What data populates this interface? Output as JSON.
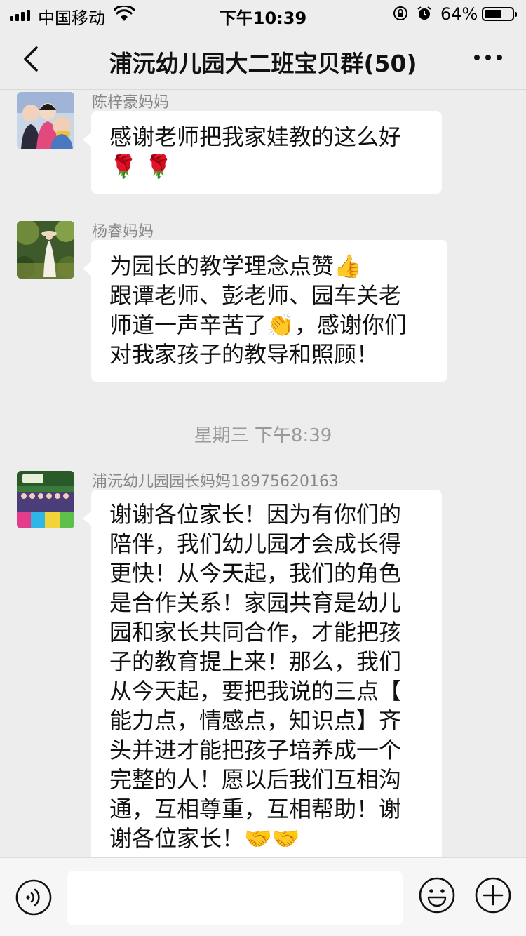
{
  "status_bar": {
    "carrier": "中国移动",
    "time": "下午10:39",
    "battery_percent": "64%",
    "battery_level": 0.64,
    "icons": [
      "signal-icon",
      "wifi-icon",
      "orientation-lock-icon",
      "alarm-icon",
      "battery-icon"
    ]
  },
  "nav": {
    "title": "浦沅幼儿园大二班宝贝群(50)",
    "back_icon": "chevron-left-icon",
    "more_icon": "more-dots-icon"
  },
  "messages": [
    {
      "sender": "陈梓豪妈妈",
      "lines": [
        "感谢老师把我家娃教的这么好",
        "🌹 🌹"
      ],
      "avatar": "family-photo-avatar"
    },
    {
      "sender": "杨睿妈妈",
      "lines": [
        "为园长的教学理念点赞👍",
        "跟谭老师、彭老师、园车关老",
        "师道一声辛苦了👏，感谢你们",
        "对我家孩子的教导和照顾！"
      ],
      "avatar": "garden-lady-avatar"
    },
    {
      "sender": "浦沅幼儿园园长妈妈18975620163",
      "lines": [
        "谢谢各位家长！因为有你们的",
        "陪伴，我们幼儿园才会成长得",
        "更快！从今天起，我们的角色",
        "是合作关系！家园共育是幼儿",
        "园和家长共同合作，才能把孩",
        "子的教育提上来！那么，我们",
        "从今天起，要把我说的三点【",
        "能力点，情感点，知识点】齐",
        "头并进才能把孩子培养成一个",
        "完整的人！愿以后我们互相沟",
        "通，互相尊重，互相帮助！谢",
        "谢各位家长！🤝🤝"
      ],
      "avatar": "kindergarten-group-avatar"
    }
  ],
  "timestamp": "星期三 下午8:39",
  "input_bar": {
    "voice_icon": "voice-icon",
    "emoji_icon": "emoji-icon",
    "plus_icon": "plus-icon",
    "text_value": ""
  },
  "colors": {
    "background": "#ededed",
    "bubble": "#ffffff",
    "sender_text": "#888888",
    "timestamp_text": "#999999"
  }
}
